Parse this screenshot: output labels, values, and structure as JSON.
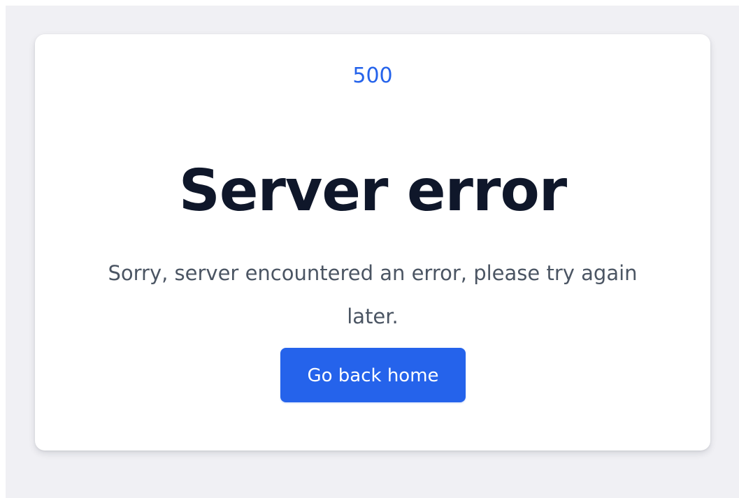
{
  "error": {
    "code": "500",
    "title": "Server error",
    "message": "Sorry, server encountered an error, please try again later.",
    "button_label": "Go back home"
  },
  "colors": {
    "page_background": "#f0f0f4",
    "card_background": "#ffffff",
    "accent": "#2563eb",
    "title_text": "#0f172a",
    "body_text": "#4b5563",
    "button_text": "#ffffff"
  }
}
